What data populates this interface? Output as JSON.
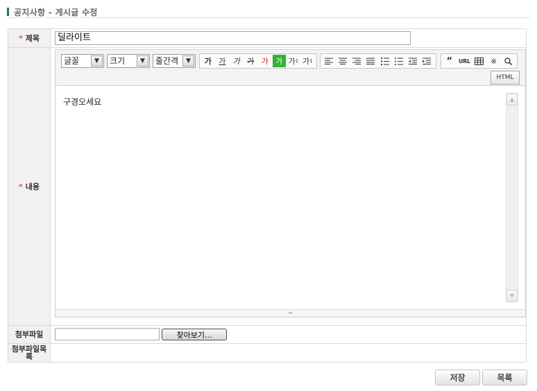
{
  "page": {
    "title": "공지사항 - 게시글 수정"
  },
  "form": {
    "required_mark": "*",
    "subject_label": "제목",
    "subject_value": "딜라이트",
    "content_label": "내용",
    "content_text": "구경오세요",
    "attachment_label": "첨부파일",
    "attachment_list_label": "첨부파일목록",
    "browse_label": "찾아보기..."
  },
  "editor": {
    "font_select": "글꼴",
    "size_select": "크기",
    "lineheight_select": "줄간격",
    "format_buttons": [
      "가",
      "가",
      "가",
      "가",
      "가",
      "가",
      "가",
      "가"
    ],
    "url_label": "URL",
    "html_label": "HTML",
    "quote_glyph": "“",
    "special_char_glyph": "※",
    "accent_green": "#2fb52f",
    "accent_red": "#d02a2a"
  },
  "actions": {
    "save_label": "저장",
    "list_label": "목록"
  }
}
